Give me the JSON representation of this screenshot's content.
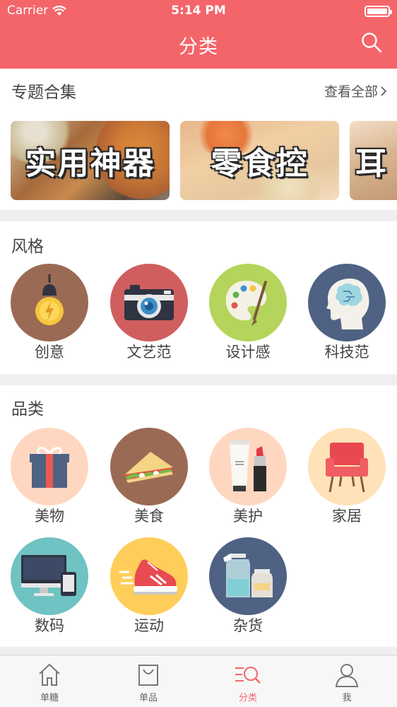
{
  "status_bar": {
    "carrier": "Carrier",
    "time": "5:14 PM"
  },
  "nav": {
    "title": "分类"
  },
  "topics": {
    "title": "专题合集",
    "view_all": "查看全部",
    "banners": [
      {
        "text": "实用神器"
      },
      {
        "text": "零食控"
      },
      {
        "text": "耳"
      }
    ]
  },
  "style": {
    "title": "风格",
    "items": [
      {
        "label": "创意",
        "icon": "lightbulb-icon",
        "color": "#9b6a54"
      },
      {
        "label": "文艺范",
        "icon": "camera-icon",
        "color": "#d05e5f"
      },
      {
        "label": "设计感",
        "icon": "palette-icon",
        "color": "#b5d45b"
      },
      {
        "label": "科技范",
        "icon": "brain-head-icon",
        "color": "#4f6283"
      }
    ]
  },
  "category": {
    "title": "品类",
    "items": [
      {
        "label": "美物",
        "icon": "gift-box-icon",
        "color": "#ffd7c0"
      },
      {
        "label": "美食",
        "icon": "sandwich-icon",
        "color": "#9b6a54"
      },
      {
        "label": "美护",
        "icon": "cosmetics-icon",
        "color": "#ffd7c0"
      },
      {
        "label": "家居",
        "icon": "armchair-icon",
        "color": "#ffe2b8"
      },
      {
        "label": "数码",
        "icon": "computer-tablet-icon",
        "color": "#6fc3c2"
      },
      {
        "label": "运动",
        "icon": "sneaker-icon",
        "color": "#ffcd5a"
      },
      {
        "label": "杂货",
        "icon": "jars-icon",
        "color": "#4f6283"
      }
    ]
  },
  "tabbar": {
    "items": [
      {
        "label": "单糖",
        "icon": "house-icon"
      },
      {
        "label": "单品",
        "icon": "shopping-bag-icon"
      },
      {
        "label": "分类",
        "icon": "category-search-icon",
        "active": true
      },
      {
        "label": "我",
        "icon": "person-icon"
      }
    ]
  },
  "colors": {
    "brand": "#f4656a"
  }
}
